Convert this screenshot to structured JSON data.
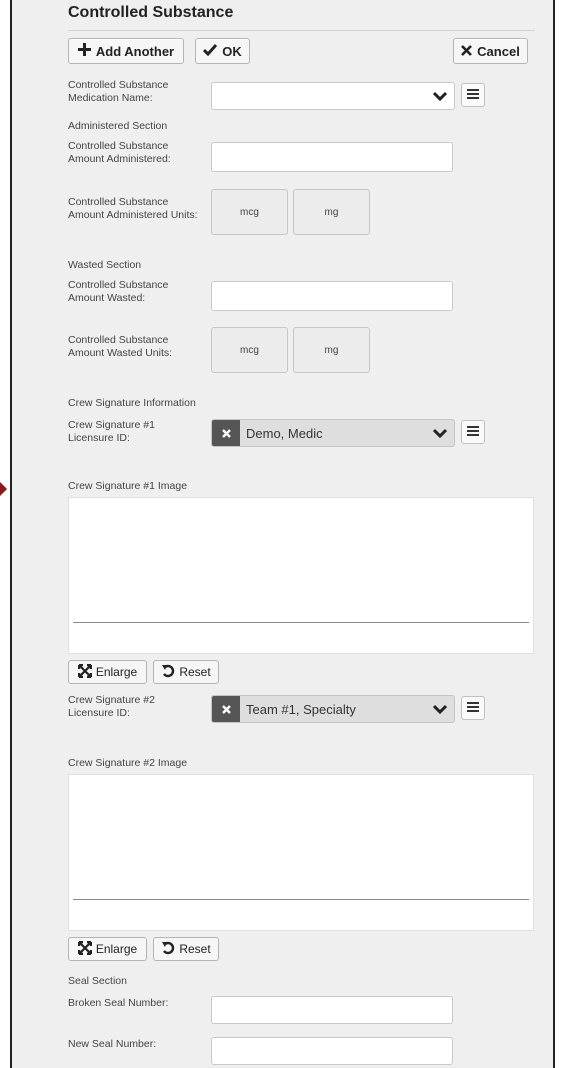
{
  "header": {
    "title": "Controlled Substance",
    "add_another_label": "Add Another",
    "ok_label": "OK",
    "cancel_label": "Cancel"
  },
  "fields": {
    "medication_name_label": "Controlled Substance Medication Name:",
    "medication_name_value": "",
    "administered_section": "Administered Section",
    "amount_administered_label": "Controlled Substance Amount Administered:",
    "amount_administered_value": "",
    "amount_administered_units_label": "Controlled Substance Amount Administered Units:",
    "units_options": [
      "mcg",
      "mg"
    ],
    "wasted_section": "Wasted Section",
    "amount_wasted_label": "Controlled Substance Amount Wasted:",
    "amount_wasted_value": "",
    "amount_wasted_units_label": "Controlled Substance Amount Wasted Units:"
  },
  "crew": {
    "section_title": "Crew Signature Information",
    "sig1_licensure_label": "Crew Signature #1 Licensure ID:",
    "sig1_value": "Demo, Medic",
    "sig1_image_label": "Crew Signature #1 Image",
    "sig2_licensure_label": "Crew Signature #2 Licensure ID:",
    "sig2_value": "Team #1, Specialty",
    "sig2_image_label": "Crew Signature #2 Image",
    "enlarge_label": "Enlarge",
    "reset_label": "Reset"
  },
  "seal": {
    "section_title": "Seal Section",
    "broken_seal_label": "Broken Seal Number:",
    "broken_seal_value": "",
    "new_seal_label": "New Seal Number:",
    "new_seal_value": ""
  },
  "icons": {
    "add": "plus-icon",
    "ok": "check-icon",
    "cancel": "x-icon",
    "dropdown": "chevron-down-icon",
    "list": "list-icon",
    "clear": "clear-icon",
    "enlarge": "expand-icon",
    "reset": "undo-icon"
  }
}
